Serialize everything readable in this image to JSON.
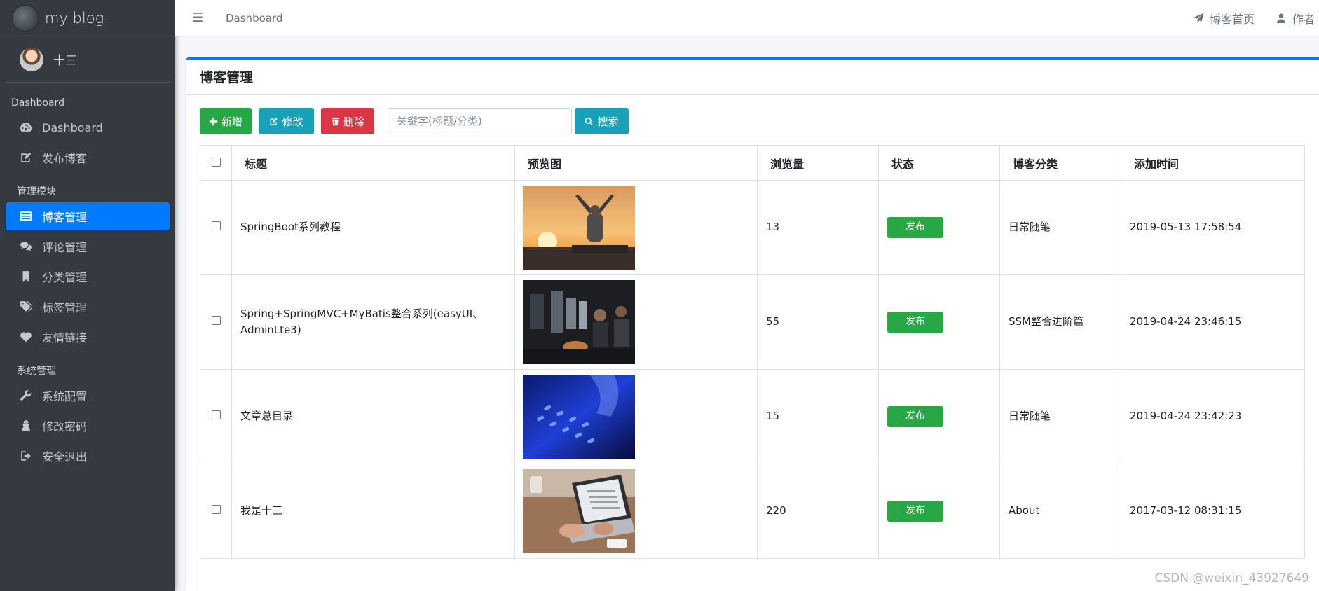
{
  "brand": {
    "name": "my blog"
  },
  "user": {
    "name": "十三"
  },
  "sidebar": {
    "sections": [
      {
        "header": "Dashboard",
        "items": [
          {
            "label": "Dashboard",
            "icon": "dashboard-icon"
          },
          {
            "label": "发布博客",
            "icon": "edit-icon"
          }
        ]
      },
      {
        "header": "管理模块",
        "items": [
          {
            "label": "博客管理",
            "icon": "list-icon",
            "active": true
          },
          {
            "label": "评论管理",
            "icon": "comments-icon"
          },
          {
            "label": "分类管理",
            "icon": "bookmark-icon"
          },
          {
            "label": "标签管理",
            "icon": "tags-icon"
          },
          {
            "label": "友情链接",
            "icon": "heart-icon"
          }
        ]
      },
      {
        "header": "系统管理",
        "items": [
          {
            "label": "系统配置",
            "icon": "wrench-icon"
          },
          {
            "label": "修改密码",
            "icon": "user-secret-icon"
          },
          {
            "label": "安全退出",
            "icon": "sign-out-icon"
          }
        ]
      }
    ]
  },
  "topbar": {
    "breadcrumb": "Dashboard",
    "home_link": "博客首页",
    "author_link": "作者"
  },
  "card": {
    "title": "博客管理"
  },
  "toolbar": {
    "add_label": "新增",
    "edit_label": "修改",
    "delete_label": "删除",
    "search_placeholder": "关键字(标题/分类)",
    "search_label": "搜索"
  },
  "table": {
    "columns": [
      "标题",
      "预览图",
      "浏览量",
      "状态",
      "博客分类",
      "添加时间"
    ],
    "rows": [
      {
        "title": "SpringBoot系列教程",
        "views": "13",
        "status": "发布",
        "category": "日常随笔",
        "time": "2019-05-13 17:58:54",
        "image": "sunset-person-thumbnail"
      },
      {
        "title": "Spring+SpringMVC+MyBatis整合系列(easyUI、AdminLte3)",
        "views": "55",
        "status": "发布",
        "category": "SSM整合进阶篇",
        "time": "2019-04-24 23:46:15",
        "image": "office-computers-thumbnail"
      },
      {
        "title": "文章总目录",
        "views": "15",
        "status": "发布",
        "category": "日常随笔",
        "time": "2019-04-24 23:42:23",
        "image": "blue-keyboard-thumbnail"
      },
      {
        "title": "我是十三",
        "views": "220",
        "status": "发布",
        "category": "About",
        "time": "2017-03-12 08:31:15",
        "image": "laptop-typing-thumbnail"
      }
    ]
  },
  "watermark": "CSDN @weixin_43927649",
  "colors": {
    "sidebar": "#343a40",
    "primary": "#007bff",
    "success": "#28a745",
    "info": "#17a2b8",
    "danger": "#dc3545"
  }
}
